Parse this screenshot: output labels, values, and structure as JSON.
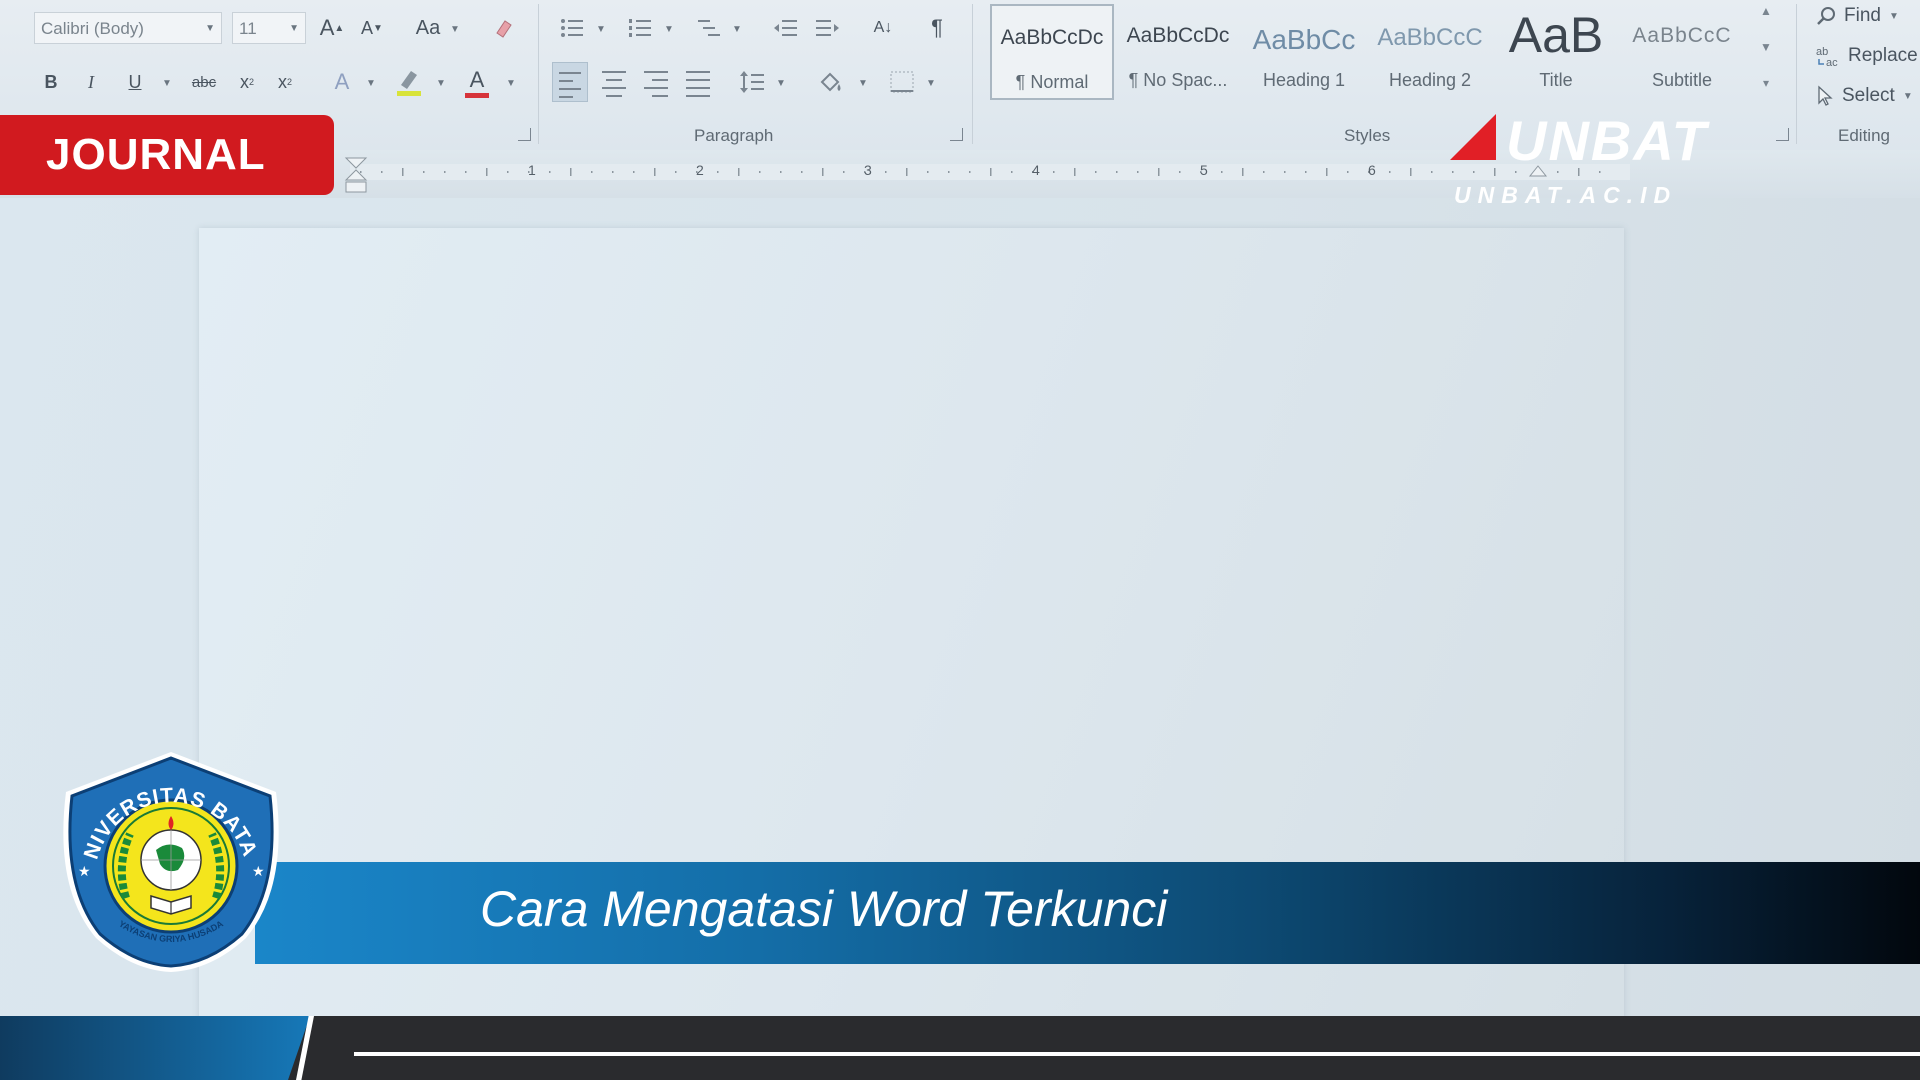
{
  "ribbon": {
    "font_name": "Calibri (Body)",
    "font_size": "11",
    "font_buttons": {
      "grow": "A",
      "shrink": "A",
      "change_case": "Aa",
      "bold": "B",
      "italic": "I",
      "underline": "U",
      "strikethrough": "abc",
      "subscript": "x",
      "superscript": "x",
      "text_effects": "A",
      "font_color": "A"
    },
    "paragraph_buttons": {
      "sort": "A↓",
      "pilcrow": "¶"
    },
    "groups": {
      "paragraph": "Paragraph",
      "styles": "Styles",
      "editing": "Editing"
    },
    "styles": [
      {
        "preview": "AaBbCcDc",
        "name": "¶ Normal"
      },
      {
        "preview": "AaBbCcDc",
        "name": "¶ No Spac..."
      },
      {
        "preview": "AaBbCc",
        "name": "Heading 1"
      },
      {
        "preview": "AaBbCcC",
        "name": "Heading 2"
      },
      {
        "preview": "AaB",
        "name": "Title"
      },
      {
        "preview": "AaBbCcC",
        "name": "Subtitle"
      }
    ],
    "editing": {
      "find": "Find",
      "replace": "Replace",
      "select": "Select"
    }
  },
  "ruler": {
    "numbers": [
      "1",
      "2",
      "3",
      "4",
      "5",
      "6"
    ]
  },
  "overlay": {
    "badge": "JOURNAL",
    "brand": "UNBAT",
    "domain": "UNBAT.AC.ID",
    "title": "Cara Mengatasi Word Terkunci",
    "seal": {
      "top_text": "UNIVERSITAS BATAM",
      "bottom_text": "YAYASAN GRIYA HUSADA"
    }
  },
  "colors": {
    "badge_red": "#d11a1f",
    "brand_red": "#e11f26",
    "banner_blue": "#1a86c9",
    "footer_dark": "#2a2b2e"
  }
}
